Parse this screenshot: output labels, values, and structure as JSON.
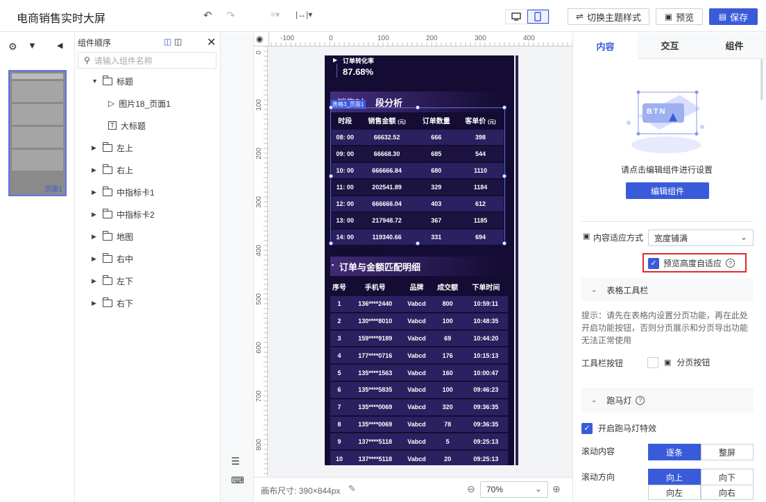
{
  "app": {
    "title": "电商销售实时大屏"
  },
  "toolbar": {
    "switch_theme": "切换主题样式",
    "preview": "预览",
    "save": "保存"
  },
  "tree": {
    "header": "组件顺序",
    "search_placeholder": "请输入组件名称",
    "root": "标题",
    "children": [
      "图片18_页面1",
      "大标题"
    ],
    "folders": [
      "左上",
      "右上",
      "中指标卡1",
      "中指标卡2",
      "地图",
      "右中",
      "左下",
      "右下"
    ]
  },
  "thumbnail": {
    "label": "页面1"
  },
  "ruler": {
    "top": [
      "-100",
      "0",
      "100",
      "200",
      "300",
      "400"
    ],
    "left": [
      "0",
      "100",
      "200",
      "300",
      "400",
      "500",
      "600",
      "700",
      "800"
    ]
  },
  "phone": {
    "kpi_label": "订单转化率",
    "kpi_value": "87.68%",
    "section1_title": "段分析",
    "section1_title_prefix": "销售时",
    "selected_tag": "表格3_页面1",
    "table1": {
      "headers": [
        "时段",
        "销售金额",
        "订单数量",
        "客单价"
      ],
      "header_units": [
        "",
        "(元)",
        "",
        "(元)"
      ],
      "rows": [
        [
          "08: 00",
          "66632.52",
          "666",
          "398"
        ],
        [
          "09: 00",
          "66668.30",
          "685",
          "544"
        ],
        [
          "10: 00",
          "666666.84",
          "680",
          "1110"
        ],
        [
          "11: 00",
          "202541.89",
          "329",
          "1184"
        ],
        [
          "12: 00",
          "666666.04",
          "403",
          "612"
        ],
        [
          "13: 00",
          "217948.72",
          "367",
          "1185"
        ],
        [
          "14: 00",
          "119340.66",
          "331",
          "694"
        ]
      ]
    },
    "section2_title": "订单与金额匹配明细",
    "table2": {
      "headers": [
        "序号",
        "手机号",
        "品牌",
        "成交额",
        "下单时间"
      ],
      "rows": [
        [
          "1",
          "136****2440",
          "Vabcd",
          "800",
          "10:59:11"
        ],
        [
          "2",
          "130****8010",
          "Vabcd",
          "100",
          "10:48:35"
        ],
        [
          "3",
          "159****9189",
          "Vabcd",
          "69",
          "10:44:20"
        ],
        [
          "4",
          "177****0716",
          "Vabcd",
          "176",
          "10:15:13"
        ],
        [
          "5",
          "135****1563",
          "Vabcd",
          "160",
          "10:00:47"
        ],
        [
          "6",
          "135****5835",
          "Vabcd",
          "100",
          "09:46:23"
        ],
        [
          "7",
          "135****0069",
          "Vabcd",
          "320",
          "09:36:35"
        ],
        [
          "8",
          "135****0069",
          "Vabcd",
          "78",
          "09:36:35"
        ],
        [
          "9",
          "137****5118",
          "Vabcd",
          "5",
          "09:25:13"
        ],
        [
          "10",
          "137****5118",
          "Vabcd",
          "20",
          "09:25:13"
        ]
      ]
    }
  },
  "canvas": {
    "size_label": "画布尺寸: 390×844px",
    "zoom": "70%"
  },
  "right": {
    "tabs": [
      "内容",
      "交互",
      "组件"
    ],
    "illustration_text": "BTN",
    "hint": "请点击编辑组件进行设置",
    "edit_button": "编辑组件",
    "fit_label": "内容适应方式",
    "fit_value": "宽度铺满",
    "preview_height": "预览高度自适应",
    "toolbar_section": "表格工具栏",
    "toolbar_tip": "提示：请先在表格内设置分页功能，再在此处开启功能按钮，否则分页展示和分页导出功能无法正常使用",
    "toolbar_button_label": "工具栏按钮",
    "paging_button": "分页按钮",
    "marquee_section": "跑马灯",
    "marquee_enable": "开启跑马灯特效",
    "scroll_content_label": "滚动内容",
    "scroll_content_options": [
      "逐条",
      "整屏"
    ],
    "scroll_dir_label": "滚动方向",
    "scroll_dir_options": [
      "向上",
      "向下",
      "向左",
      "向右"
    ]
  },
  "colors": {
    "accent": "#3a5bd9",
    "dark_bg": "#140c33",
    "highlight": "#e5262b"
  }
}
